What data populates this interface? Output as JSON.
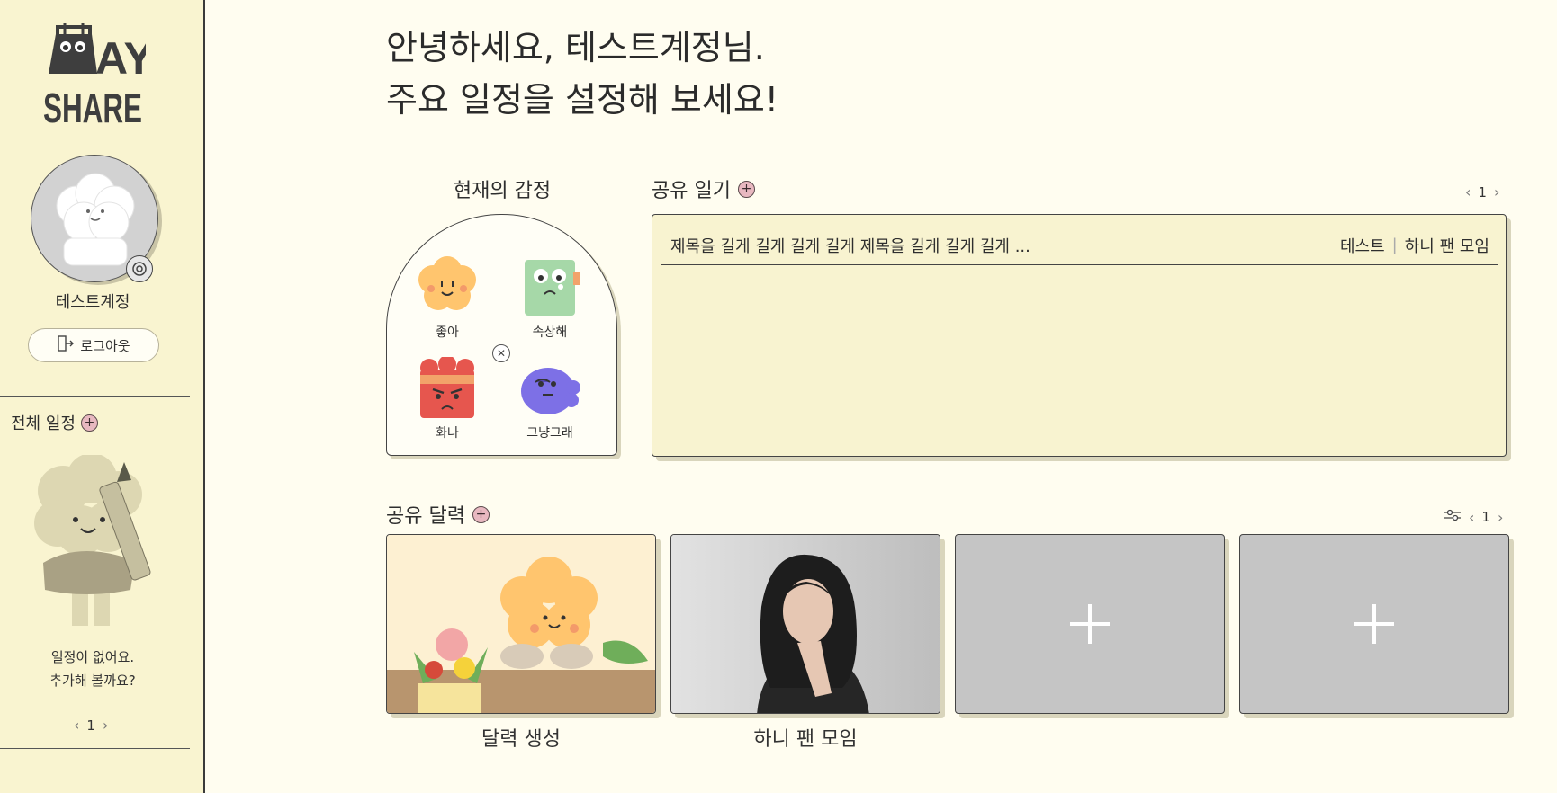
{
  "sidebar": {
    "logo_alt": "DAY SHARE",
    "username": "테스트계정",
    "logout_label": "로그아웃",
    "schedule_title": "전체 일정",
    "empty_line1": "일정이 없어요.",
    "empty_line2": "추가해 볼까요?",
    "page": "1"
  },
  "main": {
    "greeting_line1": "안녕하세요, 테스트계정님.",
    "greeting_line2": "주요 일정을 설정해 보세요!",
    "emotion": {
      "title": "현재의 감정",
      "items": [
        {
          "label": "좋아",
          "icon": "happy-flower-icon",
          "color": "#ffc56e"
        },
        {
          "label": "속상해",
          "icon": "sad-notebook-icon",
          "color": "#a6d8a8"
        },
        {
          "label": "화나",
          "icon": "angry-box-icon",
          "color": "#e6564e"
        },
        {
          "label": "그냥그래",
          "icon": "meh-blob-icon",
          "color": "#7d70e6"
        }
      ]
    },
    "diary": {
      "title": "공유 일기",
      "page": "1",
      "entries": [
        {
          "title": "제목을 길게 길게 길게 길게 제목을 길게 길게 길게 ...",
          "author": "테스트",
          "group": "하니 팬 모임"
        }
      ]
    },
    "calendar": {
      "title": "공유 달력",
      "page": "1",
      "cards": [
        {
          "label": "달력 생성",
          "type": "illustration"
        },
        {
          "label": "하니 팬 모임",
          "type": "photo"
        },
        {
          "label": "",
          "type": "add"
        },
        {
          "label": "",
          "type": "add"
        }
      ]
    }
  },
  "colors": {
    "sidebar_bg": "#f9f4d0",
    "page_bg": "#fffdf0",
    "card_bg": "#f8f3d0",
    "add_card_bg": "#c5c5c5",
    "plus_accent": "#e8b8c0"
  }
}
